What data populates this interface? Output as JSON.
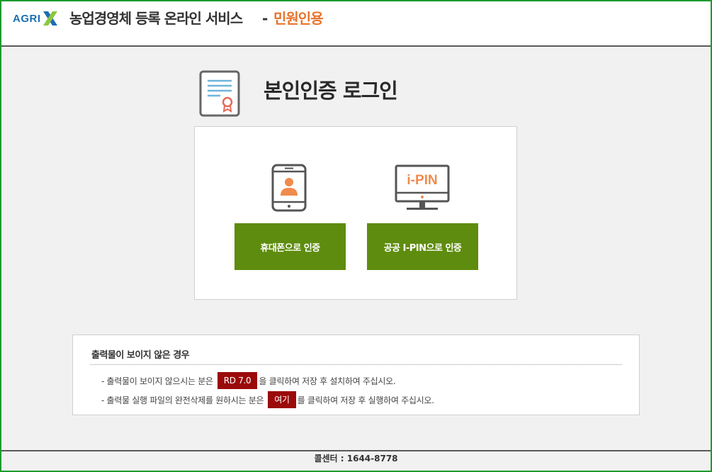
{
  "header": {
    "logo": "AGRIX",
    "title": "농업경영체 등록 온라인 서비스",
    "dash": "-",
    "subtitle": "민원인용"
  },
  "login": {
    "title": "본인인증 로그인",
    "phone_button": "휴대폰으로 인증",
    "ipin_button": "공공 I-PIN으로 인증",
    "ipin_icon_label": "i-PIN"
  },
  "notice": {
    "title": "출력물이 보이지 않은 경우",
    "line1_prefix": "- 출력물이 보이지 않으시는 분은",
    "line1_tag": "RD 7.0",
    "line1_suffix": "을 클릭하여 저장 후 설치하여 주십시오.",
    "line2_prefix": "- 출력물 실행 파일의 완전삭제를 원하시는 분은",
    "line2_tag": "여기",
    "line2_suffix": "를 클릭하여 저장 후 실행하여 주십시오."
  },
  "footer": {
    "call_center": "콜센터 : 1644-8778"
  },
  "colors": {
    "accent_green": "#5e8c0e",
    "brand_blue": "#1a6fb0",
    "subtitle_orange": "#e8732a",
    "tag_red": "#9b0a0a",
    "frame_green": "#1e9b2e"
  }
}
